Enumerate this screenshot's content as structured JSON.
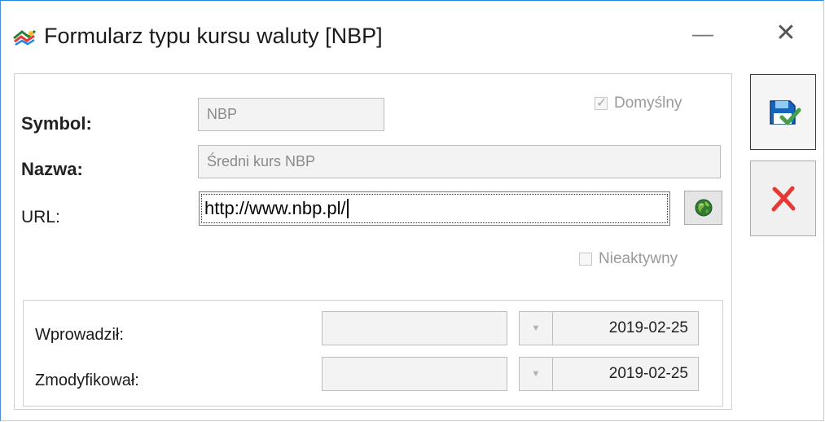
{
  "window": {
    "title": "Formularz typu kursu waluty [NBP]",
    "minimize_glyph": "—",
    "close_glyph": "✕"
  },
  "form": {
    "symbol_label": "Symbol:",
    "symbol_value": "NBP",
    "default_label": "Domyślny",
    "default_checked": true,
    "name_label": "Nazwa:",
    "name_value": "Średni kurs NBP",
    "url_label": "URL:",
    "url_value": "http://www.nbp.pl/",
    "inactive_label": "Nieaktywny",
    "inactive_checked": false
  },
  "audit": {
    "created_label": "Wprowadził:",
    "created_user": "",
    "created_date": "2019-02-25",
    "modified_label": "Zmodyfikował:",
    "modified_user": "",
    "modified_date": "2019-02-25"
  },
  "icons": {
    "app": "currency-icon",
    "open_url": "globe-icon",
    "save": "save-disk-icon",
    "cancel": "red-x-icon"
  },
  "colors": {
    "accent_border": "#1e88e5",
    "save_blue": "#1565c0",
    "save_check_green": "#43a047",
    "cancel_red": "#e53935"
  }
}
